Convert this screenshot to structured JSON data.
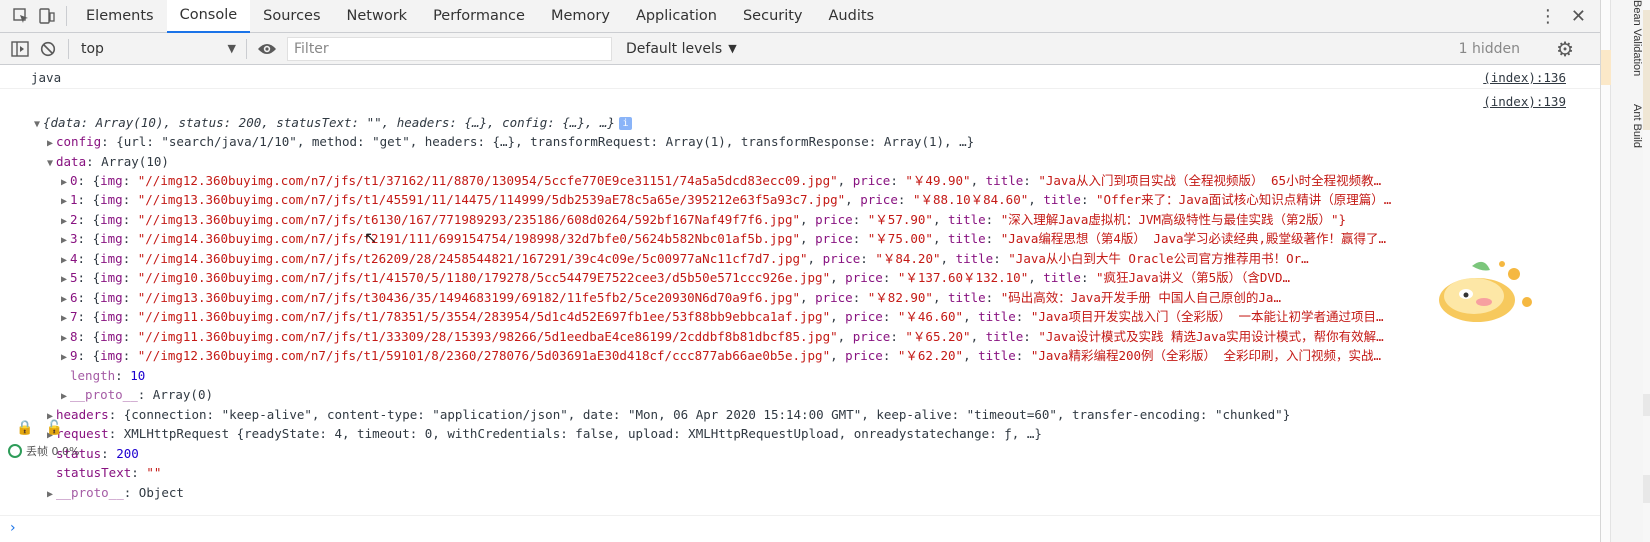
{
  "tabs": [
    "Elements",
    "Console",
    "Sources",
    "Network",
    "Performance",
    "Memory",
    "Application",
    "Security",
    "Audits"
  ],
  "active_tab": "Console",
  "icons": {
    "inspect": "inspect-element-icon",
    "device": "device-toolbar-icon",
    "more": "more-vertical-icon",
    "close": "close-icon",
    "sidebar": "toggle-sidebar-icon",
    "clear": "clear-console-icon",
    "eye": "live-expression-icon",
    "settings": "gear-icon"
  },
  "toolbar": {
    "context": "top",
    "filter_placeholder": "Filter",
    "levels": "Default levels",
    "hidden": "1 hidden"
  },
  "console": {
    "msg1_text": "java",
    "msg1_link": "(index):136",
    "msg2_link": "(index):139",
    "root_summary": "{data: Array(10), status: 200, statusText: \"\", headers: {…}, config: {…}, …}",
    "config": {
      "key": "config",
      "summary": "{url: \"search/java/1/10\", method: \"get\", headers: {…}, transformRequest: Array(1), transformResponse: Array(1), …}"
    },
    "data_key": "data",
    "data_summary": "Array(10)",
    "items": [
      {
        "i": "0",
        "img": "\"//img12.360buyimg.com/n7/jfs/t1/37162/11/8870/130954/5ccfe770E9ce31151/74a5a5dcd83ecc09.jpg\"",
        "price": "\"￥49.90\"",
        "title": "\"Java从入门到项目实战（全程视频版） 65小时全程视频教…"
      },
      {
        "i": "1",
        "img": "\"//img13.360buyimg.com/n7/jfs/t1/45591/11/14475/114999/5db2539aE78c5a65e/395212e63f5a93c7.jpg\"",
        "price": "\"￥88.10￥84.60\"",
        "title": "\"Offer来了：Java面试核心知识点精讲（原理篇）…"
      },
      {
        "i": "2",
        "img": "\"//img13.360buyimg.com/n7/jfs/t6130/167/771989293/235186/608d0264/592bf167Naf49f7f6.jpg\"",
        "price": "\"￥57.90\"",
        "title": "\"深入理解Java虚拟机：JVM高级特性与最佳实践（第2版）\"}"
      },
      {
        "i": "3",
        "img": "\"//img14.360buyimg.com/n7/jfs/t2191/111/699154754/198998/32d7bfe0/5624b582Nbc01af5b.jpg\"",
        "price": "\"￥75.00\"",
        "title": "\"Java编程思想（第4版） Java学习必读经典,殿堂级著作！赢得了…"
      },
      {
        "i": "4",
        "img": "\"//img14.360buyimg.com/n7/jfs/t26209/28/2458544821/167291/39c4c09e/5c00977aNc11cf7d7.jpg\"",
        "price": "\"￥84.20\"",
        "title": "\"Java从小白到大牛 Oracle公司官方推荐用书！Or…"
      },
      {
        "i": "5",
        "img": "\"//img10.360buyimg.com/n7/jfs/t1/41570/5/1180/179278/5cc54479E7522cee3/d5b50e571ccc926e.jpg\"",
        "price": "\"￥137.60￥132.10\"",
        "title": "\"疯狂Java讲义（第5版）（含DVD…"
      },
      {
        "i": "6",
        "img": "\"//img13.360buyimg.com/n7/jfs/t30436/35/1494683199/69182/11fe5fb2/5ce20930N6d70a9f6.jpg\"",
        "price": "\"￥82.90\"",
        "title": "\"码出高效：Java开发手册 中国人自己原创的Ja…"
      },
      {
        "i": "7",
        "img": "\"//img11.360buyimg.com/n7/jfs/t1/78351/5/3554/283954/5d1c4d52E697fb1ee/53f88bb9ebbca1af.jpg\"",
        "price": "\"￥46.60\"",
        "title": "\"Java项目开发实战入门（全彩版） 一本能让初学者通过项目…"
      },
      {
        "i": "8",
        "img": "\"//img11.360buyimg.com/n7/jfs/t1/33309/28/15393/98266/5d1eedbaE4ce86199/2cddbf8b81dbcf85.jpg\"",
        "price": "\"￥65.20\"",
        "title": "\"Java设计模式及实践 精选Java实用设计模式，帮你有效解…"
      },
      {
        "i": "9",
        "img": "\"//img12.360buyimg.com/n7/jfs/t1/59101/8/2360/278076/5d03691aE30d418cf/ccc877ab66ae0b5e.jpg\"",
        "price": "\"￥62.20\"",
        "title": "\"Java精彩编程200例（全彩版） 全彩印刷，入门视频，实战…"
      }
    ],
    "length_key": "length",
    "length_val": "10",
    "proto_key": "__proto__",
    "proto_array": "Array(0)",
    "headers_key": "headers",
    "headers_summary": "{connection: \"keep-alive\", content-type: \"application/json\", date: \"Mon, 06 Apr 2020 15:14:00 GMT\", keep-alive: \"timeout=60\", transfer-encoding: \"chunked\"}",
    "request_key": "request",
    "request_summary": "XMLHttpRequest {readyState: 4, timeout: 0, withCredentials: false, upload: XMLHttpRequestUpload, onreadystatechange: ƒ, …}",
    "status_key": "status",
    "status_val": "200",
    "statusText_key": "statusText",
    "statusText_val": "\"\"",
    "proto2_val": "Object"
  },
  "overlay": {
    "net_label": "丢帧 0.0%"
  },
  "sidebar": {
    "label1": "Bean Validation",
    "label2": "Ant Build"
  }
}
